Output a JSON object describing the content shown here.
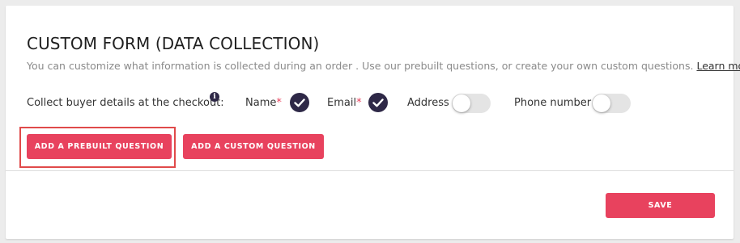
{
  "form": {
    "title": "CUSTOM FORM (DATA COLLECTION)",
    "description": "You can customize what information is collected during an order . Use our prebuilt questions, or create your own custom questions.",
    "learn_more": "Learn more",
    "collect_label": "Collect buyer details at the checkout:",
    "info_icon_glyph": "i",
    "required_mark": "*",
    "fields": [
      {
        "label": "Name",
        "required": true,
        "control": "check",
        "checked": true
      },
      {
        "label": "Email",
        "required": true,
        "control": "check",
        "checked": true
      },
      {
        "label": "Address",
        "required": false,
        "control": "toggle",
        "enabled": false
      },
      {
        "label": "Phone number",
        "required": false,
        "control": "toggle",
        "enabled": false
      }
    ],
    "buttons": {
      "add_prebuilt": "ADD A PREBUILT QUESTION",
      "add_custom": "ADD A CUSTOM QUESTION",
      "save": "SAVE"
    }
  },
  "colors": {
    "accent": "#e8425e",
    "check_bg": "#2e2847",
    "highlight_border": "#e04a4a",
    "toggle_off": "#e4e4e4"
  },
  "icons": {
    "info": "info-icon",
    "check": "checkmark-icon"
  }
}
